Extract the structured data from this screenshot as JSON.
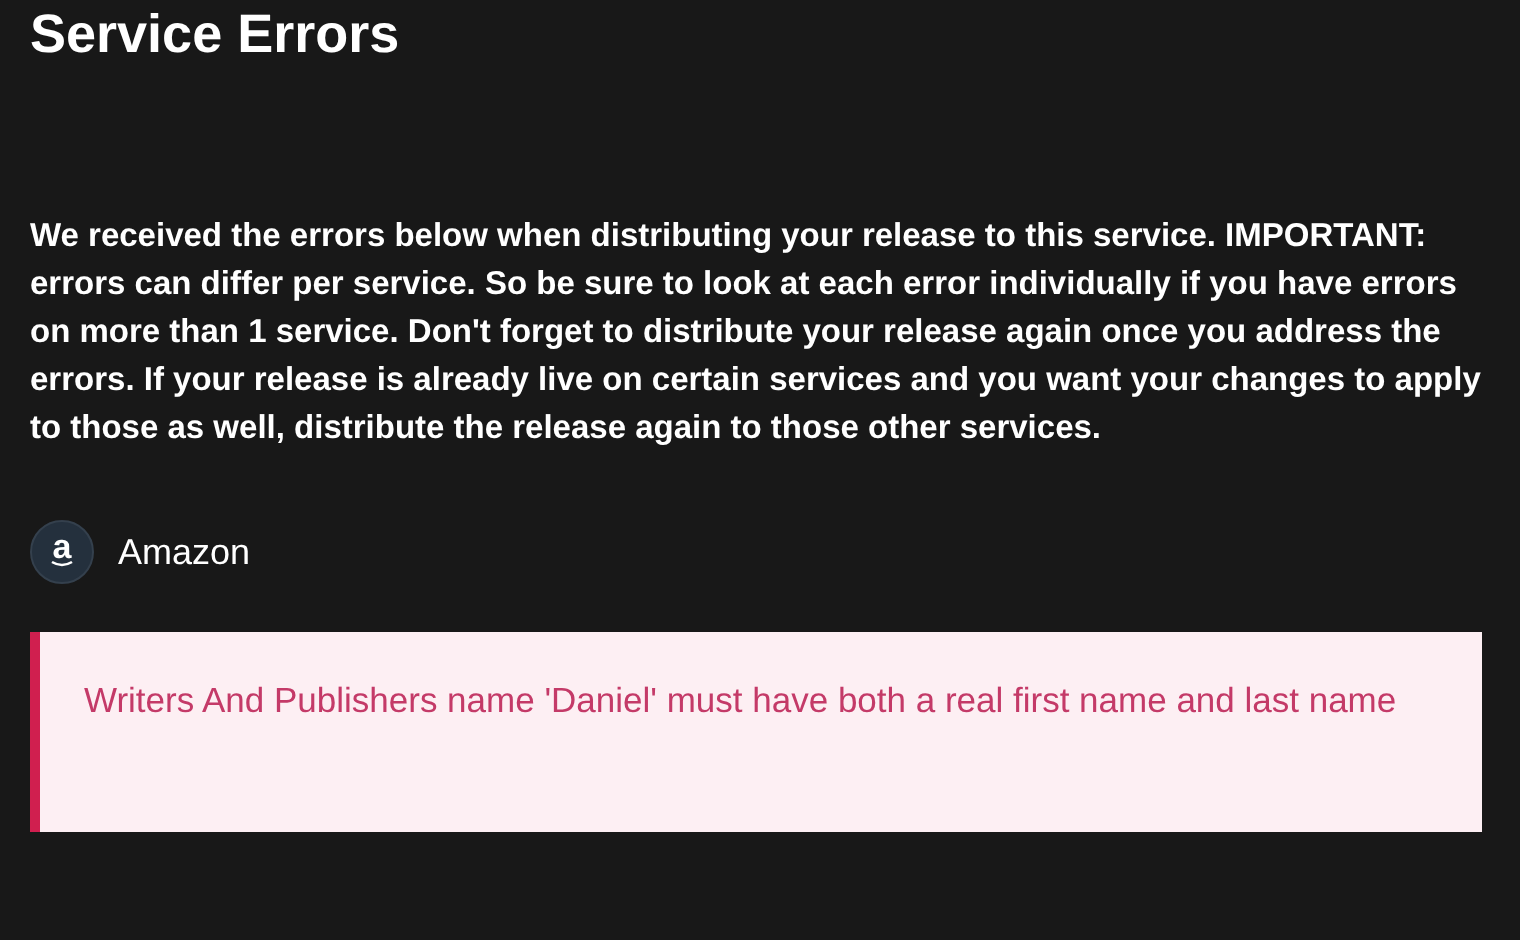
{
  "title": "Service Errors",
  "description": "We received the errors below when distributing your release to this service. IMPORTANT: errors can differ per service. So be sure to look at each error individually if you have errors on more than 1 service. Don't forget to distribute your release again once you address the errors. If your release is already live on certain services and you want your changes to apply to those as well, distribute the release again to those other services.",
  "services": [
    {
      "glyph": "a",
      "name": "Amazon",
      "errors": [
        "Writers And Publishers name 'Daniel' must have both a real first name and last name"
      ]
    }
  ]
}
